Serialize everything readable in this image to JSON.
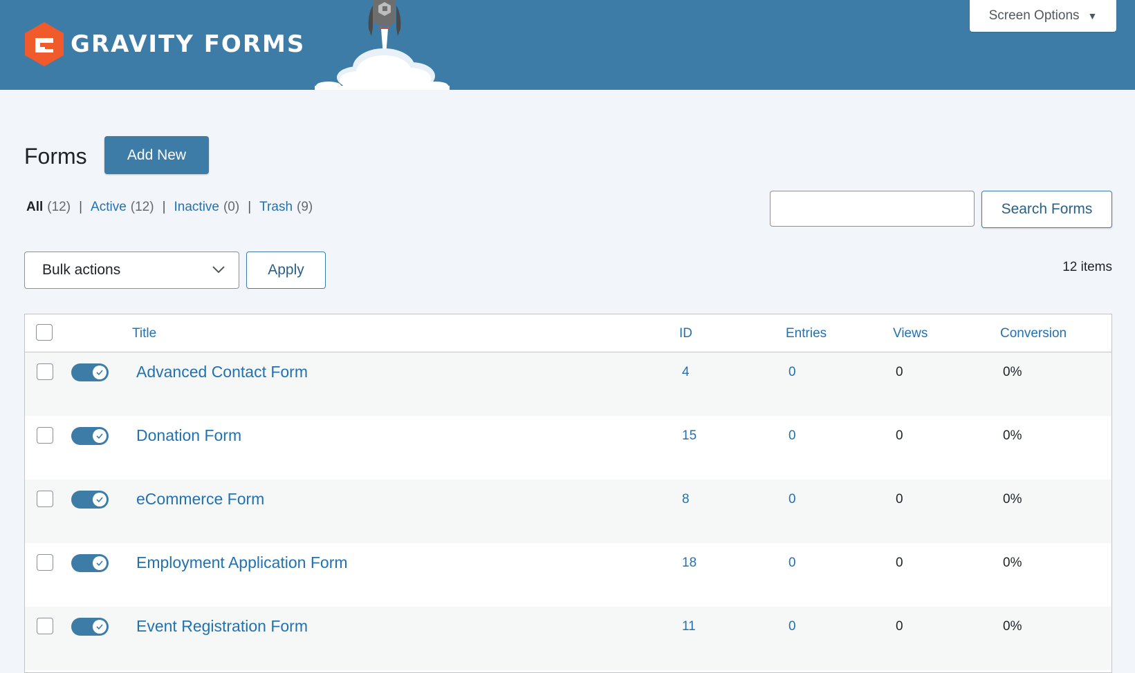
{
  "header": {
    "logo_text": "GRAVITY FORMS",
    "screen_options_label": "Screen Options",
    "accent_color": "#3e7ca8",
    "logo_color": "#f15a2b"
  },
  "page": {
    "title": "Forms",
    "add_new_label": "Add New"
  },
  "filters": [
    {
      "label": "All",
      "count": "(12)"
    },
    {
      "label": "Active",
      "count": "(12)"
    },
    {
      "label": "Inactive",
      "count": "(0)"
    },
    {
      "label": "Trash",
      "count": "(9)"
    }
  ],
  "search": {
    "value": "",
    "button_label": "Search Forms"
  },
  "bulk": {
    "selected": "Bulk actions",
    "apply_label": "Apply"
  },
  "items_count": "12 items",
  "table": {
    "columns": {
      "title": "Title",
      "id": "ID",
      "entries": "Entries",
      "views": "Views",
      "conversion": "Conversion"
    },
    "rows": [
      {
        "title": "Advanced Contact Form",
        "id": "4",
        "entries": "0",
        "views": "0",
        "conversion": "0%",
        "active": true
      },
      {
        "title": "Donation Form",
        "id": "15",
        "entries": "0",
        "views": "0",
        "conversion": "0%",
        "active": true
      },
      {
        "title": "eCommerce Form",
        "id": "8",
        "entries": "0",
        "views": "0",
        "conversion": "0%",
        "active": true
      },
      {
        "title": "Employment Application Form",
        "id": "18",
        "entries": "0",
        "views": "0",
        "conversion": "0%",
        "active": true
      },
      {
        "title": "Event Registration Form",
        "id": "11",
        "entries": "0",
        "views": "0",
        "conversion": "0%",
        "active": true
      }
    ]
  }
}
